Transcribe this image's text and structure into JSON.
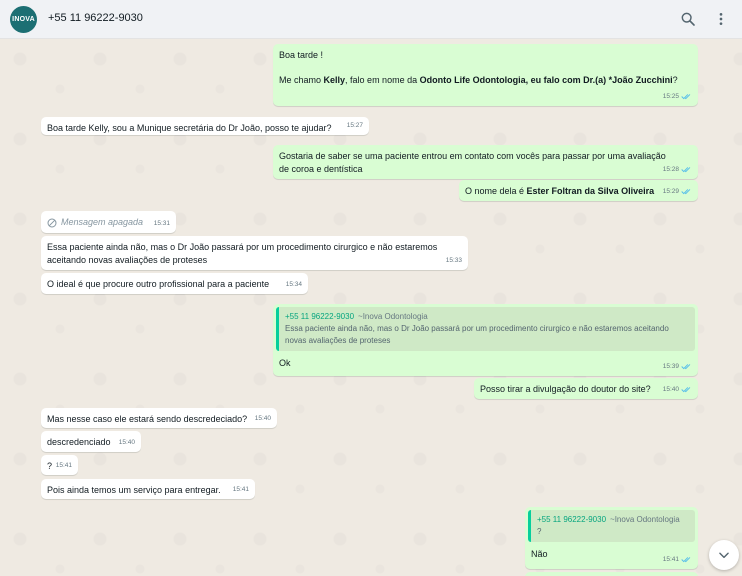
{
  "header": {
    "avatar_text": "INOVA",
    "contact": "+55 11 96222-9030",
    "search_icon": "search-icon",
    "menu_icon": "more-vertical-icon"
  },
  "messages": [
    {
      "dir": "out",
      "line1": "Boa tarde !",
      "p2a": "Me chamo ",
      "p2b": "Kelly",
      "p2c": ", falo em nome da ",
      "p2d": "Odonto Life Odontologia, eu falo com Dr.(a) *João Zucchini",
      "p2e": "?",
      "time": "15:25"
    },
    {
      "dir": "in",
      "text": "Boa tarde Kelly, sou a Munique secretária do Dr João, posso te ajudar?",
      "time": "15:27"
    },
    {
      "dir": "out",
      "text": "Gostaria de saber se uma paciente entrou em contato com vocês para passar por uma avaliação de coroa e dentística",
      "time": "15:28"
    },
    {
      "dir": "out",
      "text_a": "O nome dela é ",
      "text_b": "Ester Foltran da Silva Oliveira",
      "time": "15:29"
    },
    {
      "dir": "in",
      "deleted": "Mensagem apagada",
      "time": "15:31"
    },
    {
      "dir": "in",
      "text": "Essa paciente ainda não, mas o Dr João passará por um procedimento cirurgico e não estaremos aceitando novas avaliações de proteses",
      "time": "15:33"
    },
    {
      "dir": "in",
      "text": "O ideal é que procure outro profissional para a paciente",
      "time": "15:34"
    },
    {
      "dir": "out",
      "quote_sender": "+55 11 96222-9030",
      "quote_sub": "~Inova Odontologia",
      "quote_text": "Essa paciente ainda não, mas o Dr João passará por um procedimento cirurgico e não estaremos aceitando novas avaliações de proteses",
      "text": "Ok",
      "time": "15:39"
    },
    {
      "dir": "out",
      "text": "Posso tirar a divulgação do doutor do site?",
      "time": "15:40"
    },
    {
      "dir": "in",
      "text": "Mas nesse caso ele estará sendo descredeciado?",
      "time": "15:40"
    },
    {
      "dir": "in",
      "text": "descredenciado",
      "time": "15:40"
    },
    {
      "dir": "in",
      "text": "?",
      "time": "15:41"
    },
    {
      "dir": "in",
      "text": "Pois ainda temos um serviço para entregar.",
      "time": "15:41"
    },
    {
      "dir": "out",
      "quote_sender": "+55 11 96222-9030",
      "quote_sub": "~Inova Odontologia",
      "quote_text": "?",
      "text": "Não",
      "time": "15:41"
    }
  ],
  "colors": {
    "incoming": "#ffffff",
    "outgoing": "#d9fdd3",
    "background": "#efeae2",
    "ticks": "#53bdeb",
    "quote_accent": "#06cf9c"
  }
}
